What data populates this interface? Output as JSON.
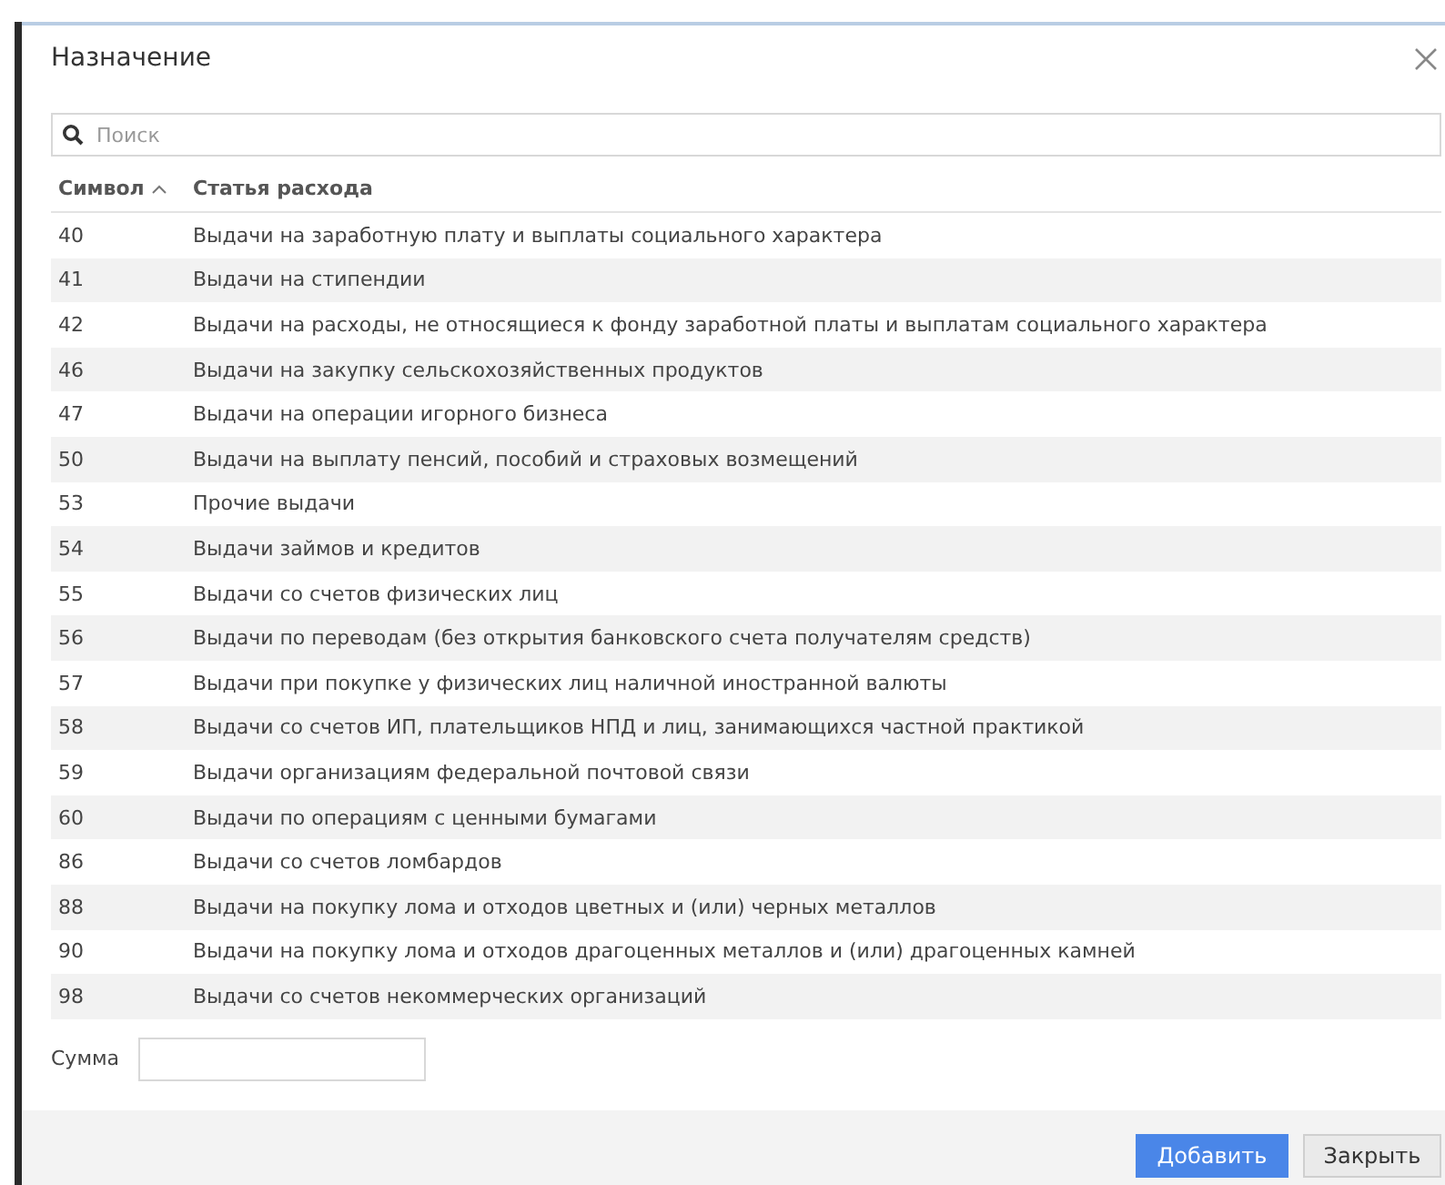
{
  "dialog": {
    "title": "Назначение"
  },
  "search": {
    "placeholder": "Поиск"
  },
  "table": {
    "columns": [
      {
        "label": "Символ",
        "sorted": true
      },
      {
        "label": "Статья расхода",
        "sorted": false
      }
    ],
    "rows": [
      {
        "symbol": "40",
        "item": "Выдачи на заработную плату и выплаты социального характера"
      },
      {
        "symbol": "41",
        "item": "Выдачи на стипендии"
      },
      {
        "symbol": "42",
        "item": "Выдачи на расходы, не относящиеся к фонду заработной платы и выплатам социального характера"
      },
      {
        "symbol": "46",
        "item": "Выдачи на закупку сельскохозяйственных продуктов"
      },
      {
        "symbol": "47",
        "item": "Выдачи на операции игорного бизнеса"
      },
      {
        "symbol": "50",
        "item": "Выдачи на выплату пенсий, пособий и страховых возмещений"
      },
      {
        "symbol": "53",
        "item": "Прочие выдачи"
      },
      {
        "symbol": "54",
        "item": "Выдачи займов и кредитов"
      },
      {
        "symbol": "55",
        "item": "Выдачи со счетов физических лиц"
      },
      {
        "symbol": "56",
        "item": "Выдачи по переводам (без открытия банковского счета получателям средств)"
      },
      {
        "symbol": "57",
        "item": "Выдачи при покупке у физических лиц наличной иностранной валюты"
      },
      {
        "symbol": "58",
        "item": "Выдачи со счетов ИП, плательщиков НПД и лиц, занимающихся частной практикой"
      },
      {
        "symbol": "59",
        "item": "Выдачи организациям федеральной почтовой связи"
      },
      {
        "symbol": "60",
        "item": "Выдачи по операциям с ценными бумагами"
      },
      {
        "symbol": "86",
        "item": "Выдачи со счетов ломбардов"
      },
      {
        "symbol": "88",
        "item": "Выдачи на покупку лома и отходов цветных и (или) черных металлов"
      },
      {
        "symbol": "90",
        "item": "Выдачи на покупку лома и отходов драгоценных металлов и (или) драгоценных камней"
      },
      {
        "symbol": "98",
        "item": "Выдачи со счетов некоммерческих организаций"
      }
    ]
  },
  "sum": {
    "label": "Сумма"
  },
  "buttons": [
    {
      "label": "Добавить",
      "kind": "primary"
    },
    {
      "label": "Закрыть",
      "kind": "secondary"
    }
  ]
}
